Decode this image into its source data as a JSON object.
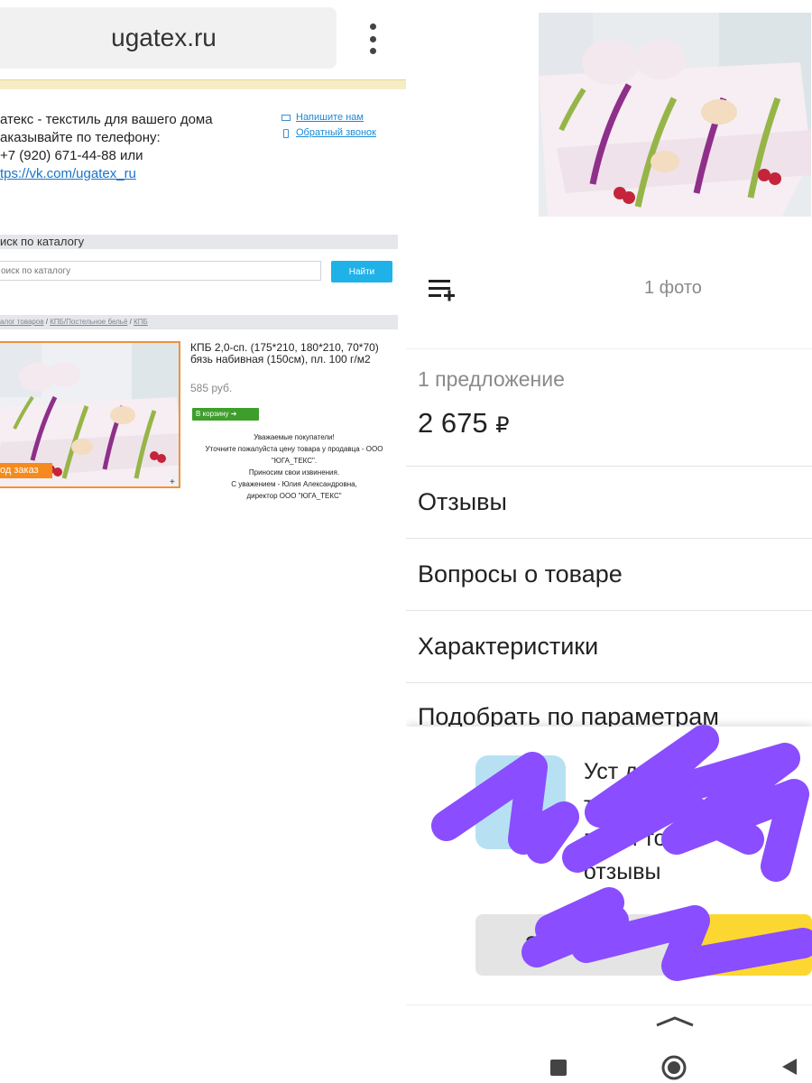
{
  "browser": {
    "url": "ugatex.ru",
    "menu_icon": "overflow-menu-icon"
  },
  "site": {
    "tagline": "атекс - текстиль для вашего дома",
    "order_phone_line": "аказывайте по телефону:",
    "phone": "+7 (920) 671-44-88 или",
    "vk_link": "tps://vk.com/ugatex_ru",
    "write_us": "Напишите нам",
    "callback": "Обратный звонок"
  },
  "search": {
    "heading": "иск по каталогу",
    "placeholder": "оиск по каталогу",
    "button": "Найти"
  },
  "breadcrumbs": {
    "items": [
      "алог товаров",
      "КПБ/Постельное бельё",
      "КПБ"
    ],
    "separator": " / "
  },
  "product": {
    "title": "КПБ 2,0-сп. (175*210, 180*210, 70*70) бязь набивная (150см), пл. 100 г/м2",
    "price": "585 руб.",
    "badge": "од заказ",
    "cart_button": "В корзину",
    "zoom": "+",
    "notice": [
      "Уважаемые покупатели!",
      "Уточните пожалуйста цену товара у продавца - ООО \"ЮГА_ТЕКС\".",
      "Приносим свои извинения.",
      "С уважением - Юлия Александровна,",
      "директор ООО \"ЮГА_ТЕКС\""
    ]
  },
  "app": {
    "photo_count": "1 фото",
    "offers_label": "1 предложение",
    "offers_price": "2 675",
    "currency": "₽",
    "rows": [
      "Отзывы",
      "Вопросы о товаре",
      "Характеристики",
      "Подобрать по параметрам"
    ],
    "sheet_lines": [
      "Уст              дл",
      "та                нее",
      "выби      то",
      "отзывы"
    ],
    "sheet_button": "З",
    "accent_yellow": "#fdd731",
    "scribble_color": "#8a4dff"
  },
  "nav": {
    "recent": "recent-apps-icon",
    "home": "home-icon",
    "back": "back-icon"
  }
}
